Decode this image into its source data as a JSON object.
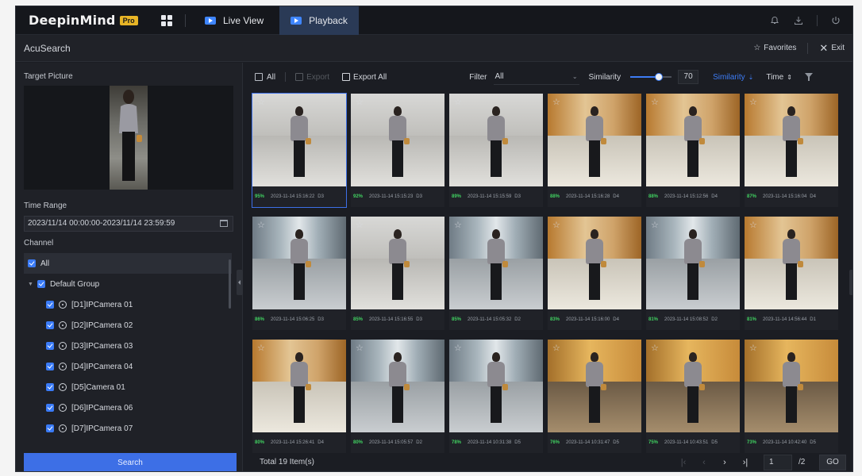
{
  "app": {
    "brand": "DeepinMind",
    "brand_badge": "Pro",
    "tabs": [
      {
        "label": "Live View",
        "active": false
      },
      {
        "label": "Playback",
        "active": true
      }
    ]
  },
  "subbar": {
    "title": "AcuSearch",
    "favorites_label": "Favorites",
    "exit_label": "Exit"
  },
  "left": {
    "target_picture_label": "Target Picture",
    "time_range_label": "Time Range",
    "time_range_value": "2023/11/14 00:00:00-2023/11/14 23:59:59",
    "channel_label": "Channel",
    "all_label": "All",
    "group_label": "Default Group",
    "cameras": [
      "[D1]IPCamera 01",
      "[D2]IPCamera 02",
      "[D3]IPCamera 03",
      "[D4]IPCamera 04",
      "[D5]Camera 01",
      "[D6]IPCamera 06",
      "[D7]IPCamera 07"
    ],
    "search_label": "Search"
  },
  "toolbar": {
    "all_label": "All",
    "export_label": "Export",
    "export_all_label": "Export All",
    "filter_label": "Filter",
    "filter_value": "All",
    "similarity_label": "Similarity",
    "similarity_value": "70",
    "similarity_fraction": 0.7,
    "sort_similarity_label": "Similarity",
    "sort_time_label": "Time"
  },
  "results": [
    {
      "pct": "95%",
      "ts": "2023-11-14 15:16:22",
      "ch": "D3",
      "scene": "hall"
    },
    {
      "pct": "92%",
      "ts": "2023-11-14 15:15:23",
      "ch": "D3",
      "scene": "hall"
    },
    {
      "pct": "89%",
      "ts": "2023-11-14 15:15:59",
      "ch": "D3",
      "scene": "hall"
    },
    {
      "pct": "88%",
      "ts": "2023-11-14 15:16:28",
      "ch": "D4",
      "scene": "wood"
    },
    {
      "pct": "88%",
      "ts": "2023-11-14 15:12:56",
      "ch": "D4",
      "scene": "wood"
    },
    {
      "pct": "87%",
      "ts": "2023-11-14 15:16:04",
      "ch": "D4",
      "scene": "wood"
    },
    {
      "pct": "86%",
      "ts": "2023-11-14 15:06:25",
      "ch": "D3",
      "scene": "door"
    },
    {
      "pct": "85%",
      "ts": "2023-11-14 15:16:55",
      "ch": "D3",
      "scene": "hall"
    },
    {
      "pct": "85%",
      "ts": "2023-11-14 15:05:32",
      "ch": "D2",
      "scene": "door"
    },
    {
      "pct": "83%",
      "ts": "2023-11-14 15:16:00",
      "ch": "D4",
      "scene": "wood"
    },
    {
      "pct": "81%",
      "ts": "2023-11-14 15:08:52",
      "ch": "D2",
      "scene": "door"
    },
    {
      "pct": "81%",
      "ts": "2023-11-14 14:56:44",
      "ch": "D1",
      "scene": "wood"
    },
    {
      "pct": "80%",
      "ts": "2023-11-14 15:26:41",
      "ch": "D4",
      "scene": "wood"
    },
    {
      "pct": "80%",
      "ts": "2023-11-14 15:05:57",
      "ch": "D2",
      "scene": "door"
    },
    {
      "pct": "78%",
      "ts": "2023-11-14 10:31:38",
      "ch": "D5",
      "scene": "door"
    },
    {
      "pct": "76%",
      "ts": "2023-11-14 10:31:47",
      "ch": "D5",
      "scene": "warm"
    },
    {
      "pct": "75%",
      "ts": "2023-11-14 10:43:51",
      "ch": "D5",
      "scene": "warm"
    },
    {
      "pct": "73%",
      "ts": "2023-11-14 10:42:40",
      "ch": "D5",
      "scene": "warm"
    }
  ],
  "footer": {
    "total_label": "Total 19 Item(s)",
    "page_current": "1",
    "page_total": "/2",
    "go_label": "GO"
  },
  "colors": {
    "accent": "#3d6fe6",
    "similarity_green": "#40d060"
  }
}
